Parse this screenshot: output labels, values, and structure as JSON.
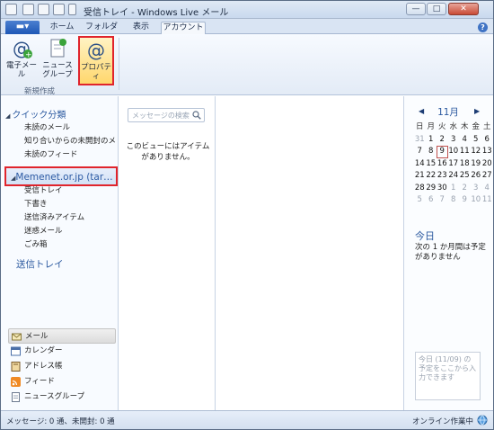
{
  "window": {
    "title": "受信トレイ - Windows Live メール",
    "minimize": "—",
    "maximize": "□",
    "close": "✕"
  },
  "tabs": {
    "file": "▬▾",
    "items": [
      "ホーム",
      "フォルダー",
      "表示",
      "アカウント"
    ],
    "active": "アカウント",
    "help": "?"
  },
  "ribbon": {
    "email_label": "電子メール",
    "newsgroup_label_1": "ニュース",
    "newsgroup_label_2": "グループ",
    "properties_label": "プロパティ",
    "group_label": "新規作成"
  },
  "nav": {
    "quick_views_header": "クイック分類",
    "quick_views": [
      "未読のメール",
      "知り合いからの未開封のメ…",
      "未読のフィード"
    ],
    "account_label": "Memenet.or.jp (tar…",
    "account_folders": [
      "受信トレイ",
      "下書き",
      "送信済みアイテム",
      "迷惑メール",
      "ごみ箱"
    ],
    "outbox_header": "送信トレイ",
    "bottom_items": [
      {
        "label": "メール",
        "icon": "mail-icon"
      },
      {
        "label": "カレンダー",
        "icon": "calendar-icon"
      },
      {
        "label": "アドレス帳",
        "icon": "address-book-icon"
      },
      {
        "label": "フィード",
        "icon": "feed-icon"
      },
      {
        "label": "ニュースグループ",
        "icon": "newsgroup-icon"
      }
    ]
  },
  "message_list": {
    "search_placeholder": "メッセージの検索",
    "empty_text": "このビューにはアイテムがありません。"
  },
  "calendar": {
    "month": "11月",
    "prev": "◀",
    "next": "▶",
    "weekdays": [
      "日",
      "月",
      "火",
      "水",
      "木",
      "金",
      "土"
    ],
    "weeks": [
      [
        "31",
        "1",
        "2",
        "3",
        "4",
        "5",
        "6"
      ],
      [
        "7",
        "8",
        "9",
        "10",
        "11",
        "12",
        "13"
      ],
      [
        "14",
        "15",
        "16",
        "17",
        "18",
        "19",
        "20"
      ],
      [
        "21",
        "22",
        "23",
        "24",
        "25",
        "26",
        "27"
      ],
      [
        "28",
        "29",
        "30",
        "1",
        "2",
        "3",
        "4"
      ],
      [
        "5",
        "6",
        "7",
        "8",
        "9",
        "10",
        "11"
      ]
    ],
    "today_day": "9",
    "today_header": "今日",
    "today_text": "次の 1 か月間は予定がありません",
    "quick_add_placeholder": "今日 (11/09) の予定をここから入力できます"
  },
  "status": {
    "left": "メッセージ: 0 通、未開封: 0 通",
    "right": "オンライン作業中"
  }
}
